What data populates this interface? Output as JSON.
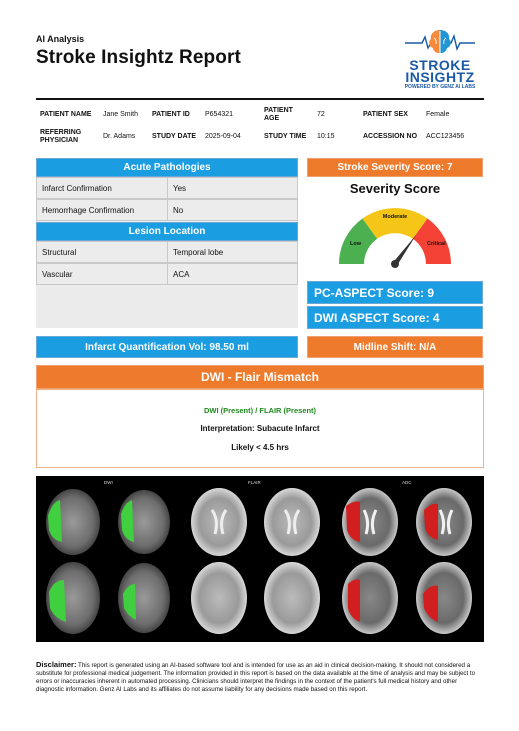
{
  "header": {
    "section_label": "AI Analysis",
    "title": "Stroke Insightz Report",
    "logo": {
      "line1": "STROKE",
      "line2": "INSIGHTZ",
      "tagline": "POWERED BY GENZ AI LABS",
      "icon": "brain-heartbeat-icon",
      "brand_color": "#1a5aa6"
    }
  },
  "patient": {
    "name_label": "PATIENT NAME",
    "name": "Jane Smith",
    "id_label": "PATIENT ID",
    "id": "P654321",
    "age_label": "PATIENT AGE",
    "age": "72",
    "sex_label": "PATIENT SEX",
    "sex": "Female",
    "physician_label": "REFERRING PHYSICIAN",
    "physician": "Dr. Adams",
    "date_label": "STUDY DATE",
    "date": "2025-09-04",
    "time_label": "STUDY TIME",
    "time": "10:15",
    "accession_label": "ACCESSION NO",
    "accession": "ACC123456"
  },
  "acute": {
    "header": "Acute Pathologies",
    "rows": [
      {
        "label": "Infarct Confirmation",
        "value": "Yes"
      },
      {
        "label": "Hemorrhage Confirmation",
        "value": "No"
      }
    ]
  },
  "lesion": {
    "header": "Lesion Location",
    "rows": [
      {
        "label": "Structural",
        "value": "Temporal lobe"
      },
      {
        "label": "Vascular",
        "value": "ACA"
      }
    ]
  },
  "severity": {
    "header": "Stroke Severity Score: 7",
    "title": "Severity Score",
    "low": "Low",
    "moderate": "Moderate",
    "critical": "Critical",
    "score": 7,
    "scale_max": 10,
    "colors": {
      "low": "#4caf50",
      "moderate": "#f5c518",
      "critical": "#f44336"
    }
  },
  "scores": {
    "pc_aspect": "PC-ASPECT Score: 9",
    "dwi_aspect": "DWI ASPECT Score: 4"
  },
  "quant": {
    "infarct_vol": "Infarct Quantification Vol: 98.50 ml",
    "midline": "Midline Shift: N/A"
  },
  "mismatch": {
    "header": "DWI - Flair Mismatch",
    "finding": "DWI (Present) / FLAIR (Present)",
    "interpretation": "Interpretation: Subacute Infarct",
    "onset": "Likely < 4.5 hrs",
    "finding_color": "#1f8a1f"
  },
  "images": {
    "labels": [
      "DWI",
      "FLAIR",
      "ADC"
    ]
  },
  "disclaimer": {
    "label": "Disclaimer:",
    "text": " This report is generated using an AI-based software tool and is intended for use as an aid in clinical decision-making. It should not considered a substitute for professional medical judgement. The information provided in this report is based on the data available at the time of analysis and may be subject to errors or inaccuracies inherent in automated processing. Clinicians should interpret the findings in the context of the patient's full medical history and other diagnostic information. Genz AI Labs and its affiliates do not assume liability for any decisions made based on this report."
  },
  "colors": {
    "blue": "#1b9de2",
    "orange": "#ee7a2c"
  }
}
